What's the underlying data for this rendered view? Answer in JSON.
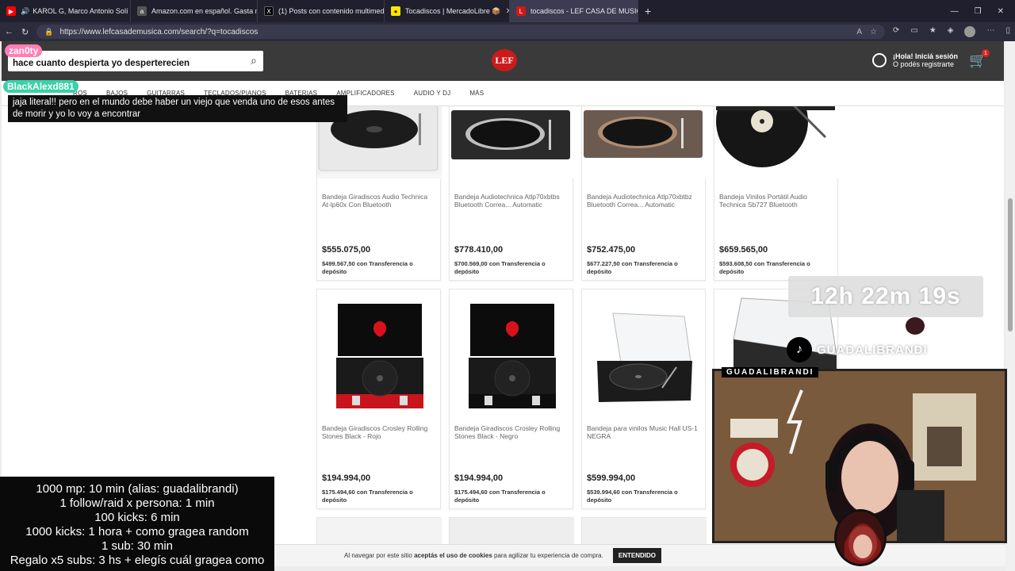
{
  "browser": {
    "tabs": [
      {
        "title": "KAROL G, Marco Antonio Solí",
        "icon": "youtube-icon",
        "color": "#ff0000"
      },
      {
        "title": "Amazon.com en español. Gasta m",
        "icon": "amazon-icon",
        "color": "#555555"
      },
      {
        "title": "(1) Posts con contenido multimed",
        "icon": "x-icon",
        "color": "#000000"
      },
      {
        "title": "Tocadiscos | MercadoLibre 📦",
        "icon": "mercadolibre-icon",
        "color": "#ffe600"
      },
      {
        "title": "tocadiscos - LEF CASA DE MUSICA",
        "icon": "lef-icon",
        "color": "#cc1a1a"
      }
    ],
    "url": "https://www.lefcasademusica.com/search/?q=tocadiscos"
  },
  "header": {
    "logo": "LEF",
    "account_line1": "¡Hola! Iniciá sesión",
    "account_line2": "O podés registrarte",
    "cart_count": "1"
  },
  "nav": {
    "items": [
      "ROS",
      "BAJOS",
      "GUITARRAS",
      "TECLADOS/PIANOS",
      "BATERIAS",
      "AMPLIFICADORES",
      "AUDIO Y DJ",
      "MÁS"
    ]
  },
  "products_row1": [
    {
      "name": "Bandeja Giradiscos Audio Technica At-lp60x Con Bluetooth",
      "price": "$555.075,00",
      "transfer_price": "$499.567,50",
      "transfer_text": "con Transferencia o depósito",
      "style": "white"
    },
    {
      "name": "Bandeja Audiotechnica Atlp70xbtbs Bluetooth Correa... Automatic",
      "price": "$778.410,00",
      "transfer_price": "$700.569,00",
      "transfer_text": "con Transferencia o depósito",
      "style": "black-silver"
    },
    {
      "name": "Bandeja Audiotechnica Atlp70xbtbz Bluetooth Correa... Automatic",
      "price": "$752.475,00",
      "transfer_price": "$677.227,50",
      "transfer_text": "con Transferencia o depósito",
      "style": "black-bronze"
    },
    {
      "name": "Bandeja Vinilos Portátil Audio Technica Sb727 Bluetooth",
      "price": "$659.565,00",
      "transfer_price": "$593.608,50",
      "transfer_text": "con Transferencia o depósito",
      "style": "portable"
    }
  ],
  "products_row2": [
    {
      "name": "Bandeja Giradiscos Crosley Rolling Stones Black - Rojo",
      "price": "$194.994,00",
      "transfer_price": "$175.494,60",
      "transfer_text": "con Transferencia o depósito",
      "style": "case-red"
    },
    {
      "name": "Bandeja Giradiscos Crosley Rolling Stones Black - Negro",
      "price": "$194.994,00",
      "transfer_price": "$175.494,60",
      "transfer_text": "con Transferencia o depósito",
      "style": "case-black"
    },
    {
      "name": "Bandeja para vinilos Music Hall US-1 NEGRA",
      "price": "$599.994,00",
      "transfer_price": "$539.994,60",
      "transfer_text": "con Transferencia o depósito",
      "style": "musichall"
    }
  ],
  "cookie_banner": {
    "text_pre": "Al navegar por este sitio ",
    "text_bold": "aceptás el uso de cookies",
    "text_post": " para agilizar tu experiencia de compra.",
    "button": "ENTENDIDO"
  },
  "stream": {
    "chat": [
      {
        "user": "zan0ty",
        "user_color": "#ff7eb6",
        "message": "hace cuanto despierta yo desperterecien"
      },
      {
        "user": "BlackAlexd881",
        "user_color": "#3ad1a8",
        "message": "jaja literal!! pero en el mundo debe haber un viejo que venda uno de esos antes de morir y yo lo voy a encontrar"
      }
    ],
    "goals": [
      "1000 mp: 10 min (alias: guadalibrandi)",
      "1 follow/raid x persona: 1 min",
      "100 kicks: 6 min",
      "1000 kicks: 1 hora + como gragea random",
      "1 sub: 30 min",
      "Regalo x5 subs: 3 hs + elegís cuál gragea como"
    ],
    "timer": "12h 22m 19s",
    "tiktok_handle": "GUADALIBRANDI",
    "cam_label": "GUADALIBRANDI"
  }
}
